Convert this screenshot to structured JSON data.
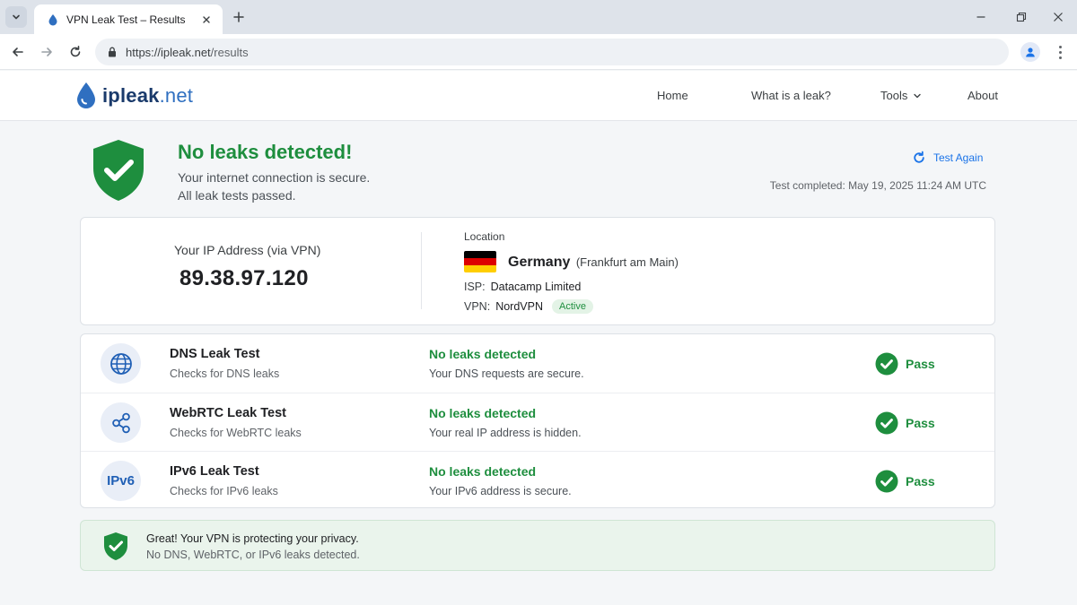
{
  "browser": {
    "tab_title": "VPN Leak Test – Results",
    "url_host": "https://ipleak.net",
    "url_path": "/results"
  },
  "site": {
    "logo_main": "ipleak",
    "logo_tld": ".net",
    "nav": [
      {
        "label": "Home"
      },
      {
        "label": "What is a leak?"
      },
      {
        "label": "Tools"
      },
      {
        "label": "About"
      }
    ]
  },
  "status": {
    "title": "No leaks detected!",
    "line1": "Your internet connection is secure.",
    "line2": "All leak tests passed.",
    "test_again": "Test Again",
    "completed": "Test completed: May 19, 2025 11:24 AM UTC"
  },
  "connection": {
    "ip_label": "Your IP Address (via VPN)",
    "ip": "89.38.97.120",
    "location_label": "Location",
    "country": "Germany",
    "city": "(Frankfurt am Main)",
    "isp_label": "ISP:",
    "isp": "Datacamp Limited",
    "vpn_label": "VPN:",
    "vpn": "NordVPN",
    "vpn_status": "Active"
  },
  "tests": [
    {
      "name": "DNS Leak Test",
      "desc": "Checks for DNS leaks",
      "result": "No leaks detected",
      "detail": "Your DNS requests are secure.",
      "status": "Pass",
      "icon": "globe-icon"
    },
    {
      "name": "WebRTC Leak Test",
      "desc": "Checks for WebRTC leaks",
      "result": "No leaks detected",
      "detail": "Your real IP address is hidden.",
      "status": "Pass",
      "icon": "share-icon"
    },
    {
      "name": "IPv6 Leak Test",
      "desc": "Checks for IPv6 leaks",
      "result": "No leaks detected",
      "detail": "Your IPv6 address is secure.",
      "status": "Pass",
      "icon_text": "IPv6"
    }
  ],
  "banner": {
    "title": "Great! Your VPN is protecting your privacy.",
    "subtitle": "No DNS, WebRTC, or IPv6 leaks detected."
  },
  "colors": {
    "success": "#1e8e3e",
    "link": "#1a73e8",
    "brand": "#1a3a6b",
    "flag": [
      "#000000",
      "#dd0000",
      "#ffce00"
    ]
  }
}
